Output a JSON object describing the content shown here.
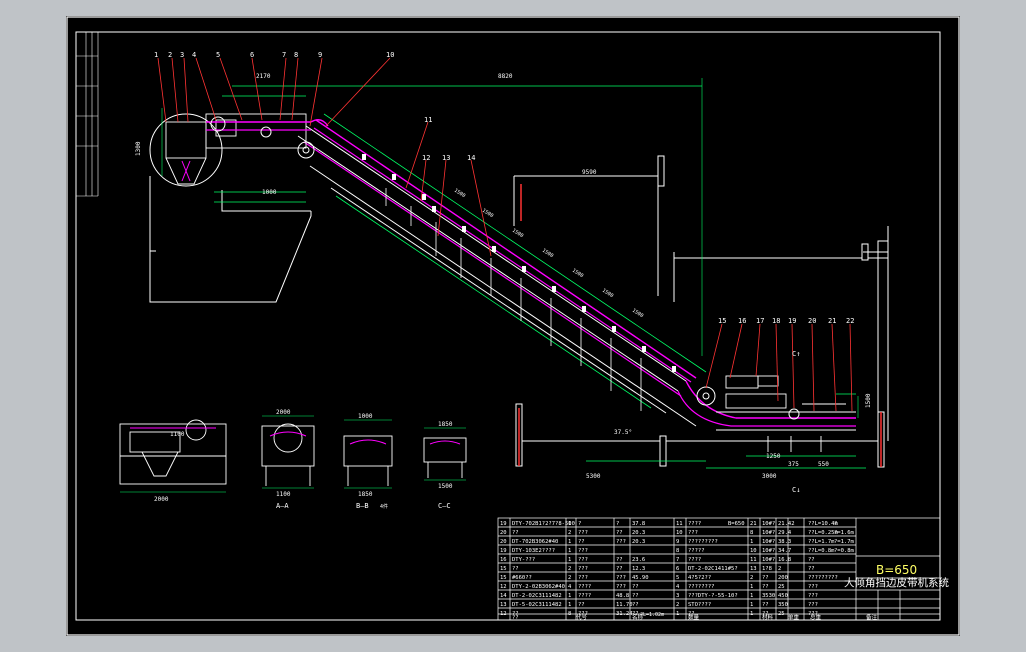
{
  "drawing": {
    "system_title": "B=650",
    "system_subtitle": "大倾角挡边皮带机系统",
    "callouts": [
      "1",
      "2",
      "3",
      "4",
      "5",
      "6",
      "7",
      "8",
      "9",
      "10",
      "11",
      "12",
      "13",
      "14",
      "15",
      "16",
      "17",
      "18",
      "19",
      "20",
      "21",
      "22"
    ],
    "dimensions": {
      "overall_length": "8820",
      "top_width": "2170",
      "head_dim_a": "1300",
      "head_dim_b": "1000",
      "tail_length": "5300",
      "tail_len2": "3000",
      "tail_dim": "1250",
      "tail_w": "375",
      "tail_w2": "550",
      "angle": "37.5°",
      "right_h": "1500",
      "elev": "9590",
      "mid_dims": [
        "1500",
        "1500",
        "1500",
        "1500",
        "1500",
        "1500",
        "1500"
      ]
    },
    "section_labels": {
      "aa": "A—A",
      "bb": "B—B",
      "cc": "C—C",
      "bb_note": "4件",
      "view": "C↑",
      "view2": "C↓"
    },
    "small_view_dims": [
      "2000",
      "2000",
      "1100",
      "1000",
      "1850",
      "1850",
      "1500",
      "1100"
    ],
    "title_block": {
      "rows": [
        [
          "19",
          "DTY-702B1?2?7?8-500",
          "1",
          "?",
          "?",
          "37.8"
        ],
        [
          "20",
          "??",
          "2",
          "???",
          "??",
          "20.3"
        ],
        [
          "20",
          "DT-702B3062#40",
          "1",
          "??",
          "???",
          "20.3"
        ],
        [
          "19",
          "DTY-103E2????",
          "1",
          "???",
          "",
          ""
        ],
        [
          "16",
          "DTY-???",
          "1",
          "???",
          "??",
          "23.6"
        ],
        [
          "15",
          "??",
          "2",
          "???",
          "??",
          "12.3"
        ],
        [
          "15",
          "#660??",
          "2",
          "???",
          "???",
          "45.90"
        ],
        [
          "12",
          "DTY-2-02B3062#40",
          "4",
          "????",
          "???",
          "??"
        ],
        [
          "14",
          "DT-2-02C3111482",
          "1",
          "????",
          "48.8",
          "??"
        ],
        [
          "13",
          "DT-5-02C3111482",
          "1",
          "??",
          "11.70",
          "??"
        ],
        [
          "12",
          "??",
          "8",
          "???",
          "31.24",
          "??"
        ]
      ],
      "rows_mid": [
        [
          "11",
          "????",
          "B=650",
          "21",
          "10#?",
          "21.42"
        ],
        [
          "10",
          "???",
          "",
          "8",
          "10#?",
          "29.4"
        ],
        [
          "9",
          "?????????",
          "",
          "1",
          "10#?",
          "38.3"
        ],
        [
          "8",
          "?????",
          "",
          "10",
          "10#?",
          "34.7"
        ],
        [
          "7",
          "????",
          "",
          "11",
          "10#?",
          "16.8"
        ],
        [
          "6",
          "DT-2-02C1411#5?",
          "",
          "13",
          "1?8",
          "2"
        ],
        [
          "5",
          "4?5?2??",
          "",
          "2",
          "??",
          "200"
        ],
        [
          "4",
          "????????",
          "",
          "1",
          "??",
          "25"
        ],
        [
          "3",
          "???DTY-?-55-10?",
          "",
          "1",
          "3530",
          "450"
        ],
        [
          "2",
          "STO????",
          "",
          "1",
          "??",
          "350"
        ],
        [
          "1",
          "??",
          "",
          "1",
          "??",
          "25"
        ]
      ],
      "rows_right": [
        "?",
        "?=1.6m",
        "?=1.7m",
        "?=0.8m",
        "",
        "",
        "",
        "",
        "",
        "",
        ""
      ],
      "right_labels": [
        "??L=10.4m",
        "??L=0.25m",
        "??L=1.7m",
        "??L=0.8m",
        "??",
        "??",
        "?????????",
        "???",
        "???",
        "???",
        "???"
      ],
      "footer": [
        "??",
        "代号",
        "名称",
        "数量",
        "材料",
        "单重",
        "总重",
        "备注"
      ],
      "extra": "?L=1.02m"
    },
    "colors": {
      "sheet": "#000000",
      "viewport": "#bfc3c7",
      "frame": "#ffffff",
      "belt": "#ff00ff",
      "green": "#00ff66",
      "callout": "#ff3333",
      "dim": "#00ff00",
      "text": "#ffffff",
      "title": "#ffff66"
    }
  }
}
